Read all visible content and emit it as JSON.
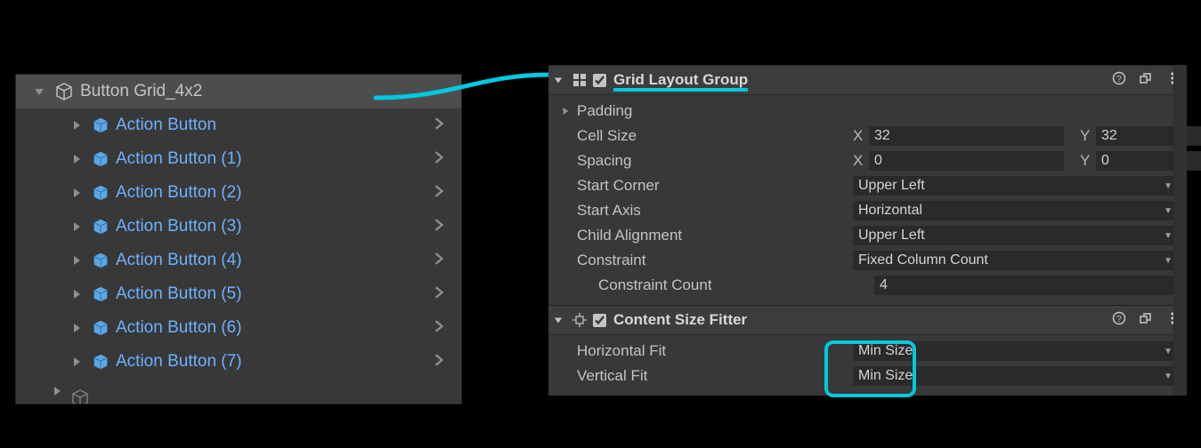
{
  "hierarchy": {
    "parent_label": "Button Grid_4x2",
    "children": [
      "Action Button",
      "Action Button (1)",
      "Action Button (2)",
      "Action Button (3)",
      "Action Button (4)",
      "Action Button (5)",
      "Action Button (6)",
      "Action Button (7)"
    ]
  },
  "inspector": {
    "grid_layout": {
      "title": "Grid Layout Group",
      "enabled": true,
      "padding_label": "Padding",
      "cell_size": {
        "label": "Cell Size",
        "x": "32",
        "y": "32"
      },
      "spacing": {
        "label": "Spacing",
        "x": "0",
        "y": "0"
      },
      "start_corner": {
        "label": "Start Corner",
        "value": "Upper Left"
      },
      "start_axis": {
        "label": "Start Axis",
        "value": "Horizontal"
      },
      "child_alignment": {
        "label": "Child Alignment",
        "value": "Upper Left"
      },
      "constraint": {
        "label": "Constraint",
        "value": "Fixed Column Count"
      },
      "constraint_count": {
        "label": "Constraint Count",
        "value": "4"
      }
    },
    "content_size_fitter": {
      "title": "Content Size Fitter",
      "enabled": true,
      "horizontal_fit": {
        "label": "Horizontal Fit",
        "value": "Min Size"
      },
      "vertical_fit": {
        "label": "Vertical Fit",
        "value": "Min Size"
      }
    },
    "axis_x": "X",
    "axis_y": "Y"
  },
  "colors": {
    "accent": "#00c8de",
    "prefab_text": "#6db1ff"
  }
}
